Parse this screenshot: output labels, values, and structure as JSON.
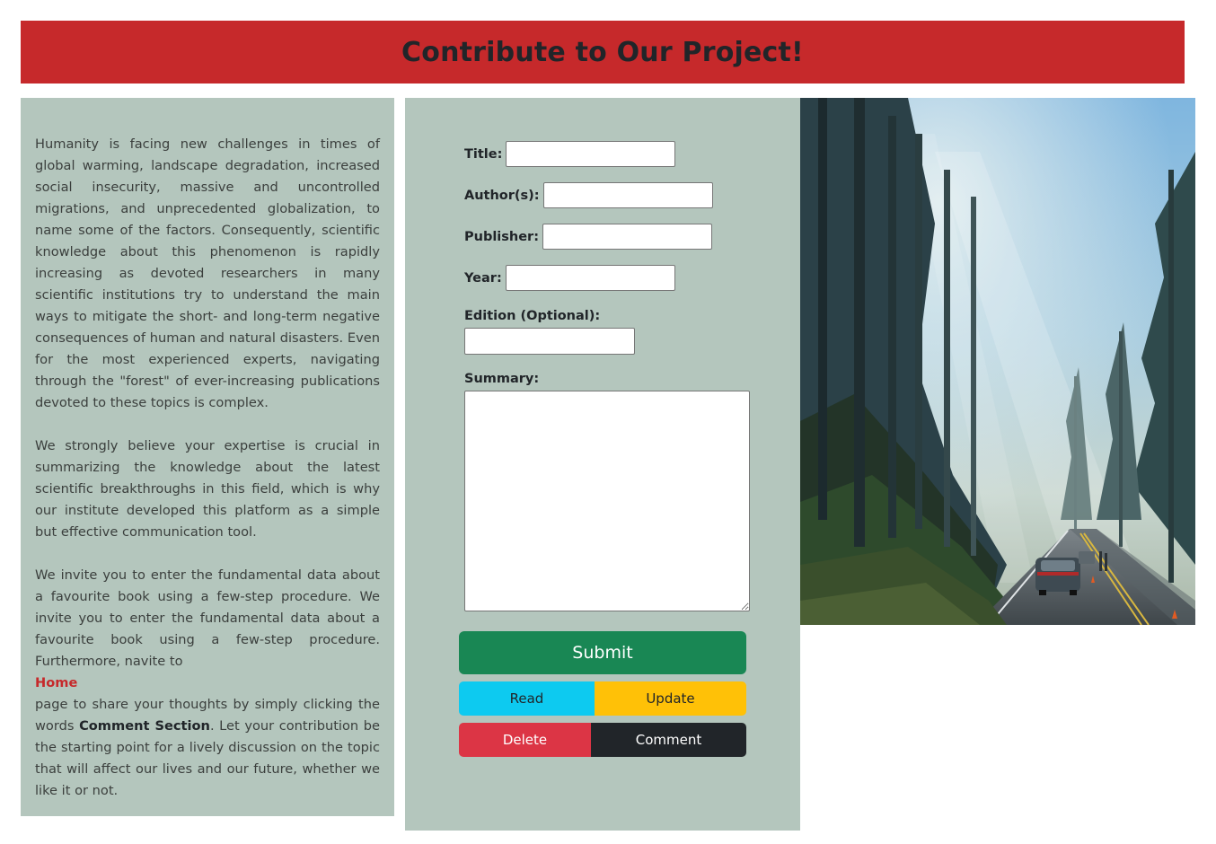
{
  "header": {
    "title": "Contribute to Our Project!"
  },
  "intro": {
    "paragraph1": "Humanity is facing new challenges in times of global warming, landscape degradation, increased social insecurity, massive and uncontrolled migrations, and unprecedented globalization, to name some of the factors. Consequently, scientific knowledge about this phenomenon is rapidly increasing as devoted researchers in many scientific institutions try to understand the main ways to mitigate the short- and long-term negative consequences of human and natural disasters. Even for the most experienced experts, navigating through the \"forest\" of ever-increasing publications devoted to these topics is complex.",
    "paragraph2": "We strongly believe your expertise is crucial in summarizing the knowledge about the latest scientific breakthroughs in this field, which is why our institute developed this platform as a simple but effective communication tool.",
    "paragraph3_start": "We invite you to enter the fundamental data about a favourite book using a few-step procedure. We invite you to enter the fundamental data about a favourite book using a few-step procedure. Furthermore, navite to",
    "home_link": "Home",
    "paragraph3_mid": "page to share your thoughts by simply clicking the words ",
    "comment_section": "Comment Section",
    "paragraph3_end": ". Let your contribution be the starting point for a lively discussion on the topic that will affect our lives and our future, whether we like it or not."
  },
  "form": {
    "title_label": "Title:",
    "title_value": "",
    "authors_label": "Author(s):",
    "authors_value": "",
    "publisher_label": "Publisher:",
    "publisher_value": "",
    "year_label": "Year:",
    "year_value": "",
    "edition_label": "Edition (Optional):",
    "edition_value": "",
    "summary_label": "Summary:",
    "summary_value": ""
  },
  "buttons": {
    "submit": "Submit",
    "read": "Read",
    "update": "Update",
    "delete": "Delete",
    "comment": "Comment"
  },
  "colors": {
    "banner": "#c6292b",
    "panel": "#b4c6bd",
    "submit": "#198754",
    "read": "#0dcaf0",
    "update": "#ffc107",
    "delete": "#dc3545",
    "comment": "#212529"
  }
}
